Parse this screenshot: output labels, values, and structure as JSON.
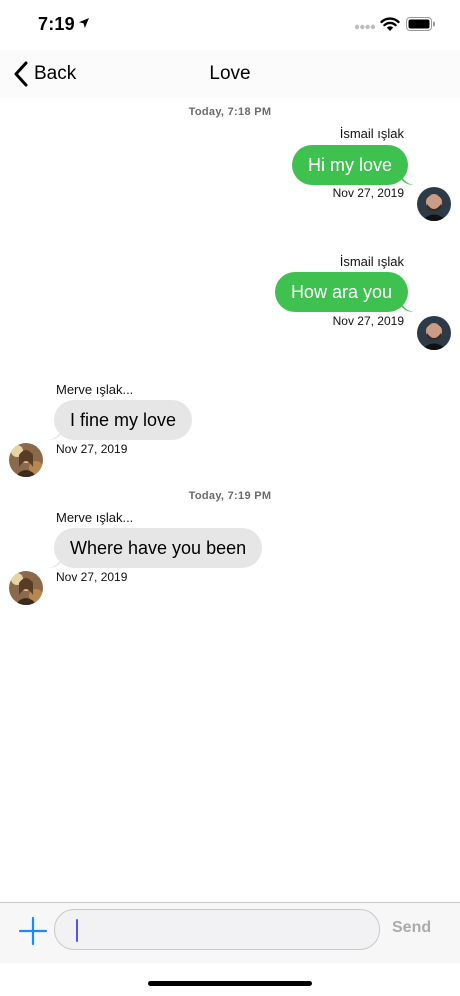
{
  "status_bar": {
    "time": "7:19"
  },
  "nav": {
    "back_label": "Back",
    "title": "Love"
  },
  "timestamps": [
    "Today, 7:18 PM",
    "Today, 7:19 PM"
  ],
  "messages": [
    {
      "sender": "İsmail ışlak",
      "text": "Hi my love",
      "date": "Nov 27, 2019",
      "direction": "outgoing"
    },
    {
      "sender": "İsmail ışlak",
      "text": "How ara you",
      "date": "Nov 27, 2019",
      "direction": "outgoing"
    },
    {
      "sender": "Merve ışlak...",
      "text": "I fine my love",
      "date": "Nov 27, 2019",
      "direction": "incoming"
    },
    {
      "sender": "Merve ışlak...",
      "text": "Where have you been",
      "date": "Nov 27, 2019",
      "direction": "incoming"
    }
  ],
  "input": {
    "value": "",
    "placeholder": "",
    "send_label": "Send"
  },
  "colors": {
    "outgoing_bubble": "#3ec14f",
    "incoming_bubble": "#e6e6e6",
    "accent": "#1a8cff"
  },
  "icons": [
    "location-arrow-icon",
    "cellular-signal-icon",
    "wifi-icon",
    "battery-icon",
    "chevron-left-icon",
    "plus-icon"
  ]
}
